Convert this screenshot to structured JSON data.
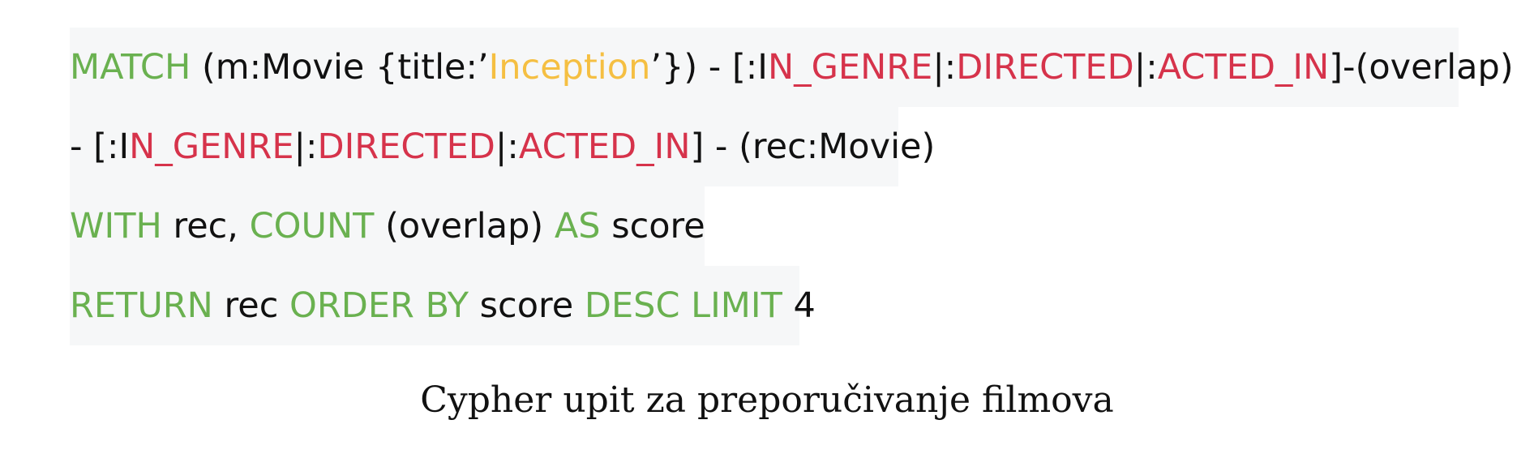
{
  "code": {
    "lines": [
      {
        "tokens": [
          {
            "text": "MATCH",
            "kind": "kw"
          },
          {
            "text": " (m:Movie {title:’",
            "kind": "plain"
          },
          {
            "text": "Inception",
            "kind": "str"
          },
          {
            "text": "’}) - [:I",
            "kind": "plain"
          },
          {
            "text": "N_GENRE",
            "kind": "rel"
          },
          {
            "text": "|:",
            "kind": "plain"
          },
          {
            "text": "DIRECTED",
            "kind": "rel"
          },
          {
            "text": "|:",
            "kind": "plain"
          },
          {
            "text": "ACTED_IN",
            "kind": "rel"
          },
          {
            "text": "]-(overlap)",
            "kind": "plain"
          }
        ]
      },
      {
        "tokens": [
          {
            "text": "- [:I",
            "kind": "plain"
          },
          {
            "text": "N_GENRE",
            "kind": "rel"
          },
          {
            "text": "|:",
            "kind": "plain"
          },
          {
            "text": "DIRECTED",
            "kind": "rel"
          },
          {
            "text": "|:",
            "kind": "plain"
          },
          {
            "text": "ACTED_IN",
            "kind": "rel"
          },
          {
            "text": "] - (rec:Movie)",
            "kind": "plain"
          }
        ]
      },
      {
        "tokens": [
          {
            "text": "WITH",
            "kind": "kw"
          },
          {
            "text": " rec, ",
            "kind": "plain"
          },
          {
            "text": "COUNT",
            "kind": "kw"
          },
          {
            "text": " (overlap) ",
            "kind": "plain"
          },
          {
            "text": "AS",
            "kind": "kw"
          },
          {
            "text": " score",
            "kind": "plain"
          }
        ]
      },
      {
        "tokens": [
          {
            "text": "RETURN",
            "kind": "kw"
          },
          {
            "text": " rec ",
            "kind": "plain"
          },
          {
            "text": "ORDER BY",
            "kind": "kw"
          },
          {
            "text": " score ",
            "kind": "plain"
          },
          {
            "text": "DESC LIMIT",
            "kind": "kw"
          },
          {
            "text": " 4",
            "kind": "plain"
          }
        ]
      }
    ]
  },
  "caption": "Cypher upit za preporučivanje filmova",
  "colors": {
    "keyword": "#6ab150",
    "string": "#f5bf42",
    "relationship": "#d6334b",
    "text": "#111111",
    "code_background": "#f6f7f8"
  }
}
